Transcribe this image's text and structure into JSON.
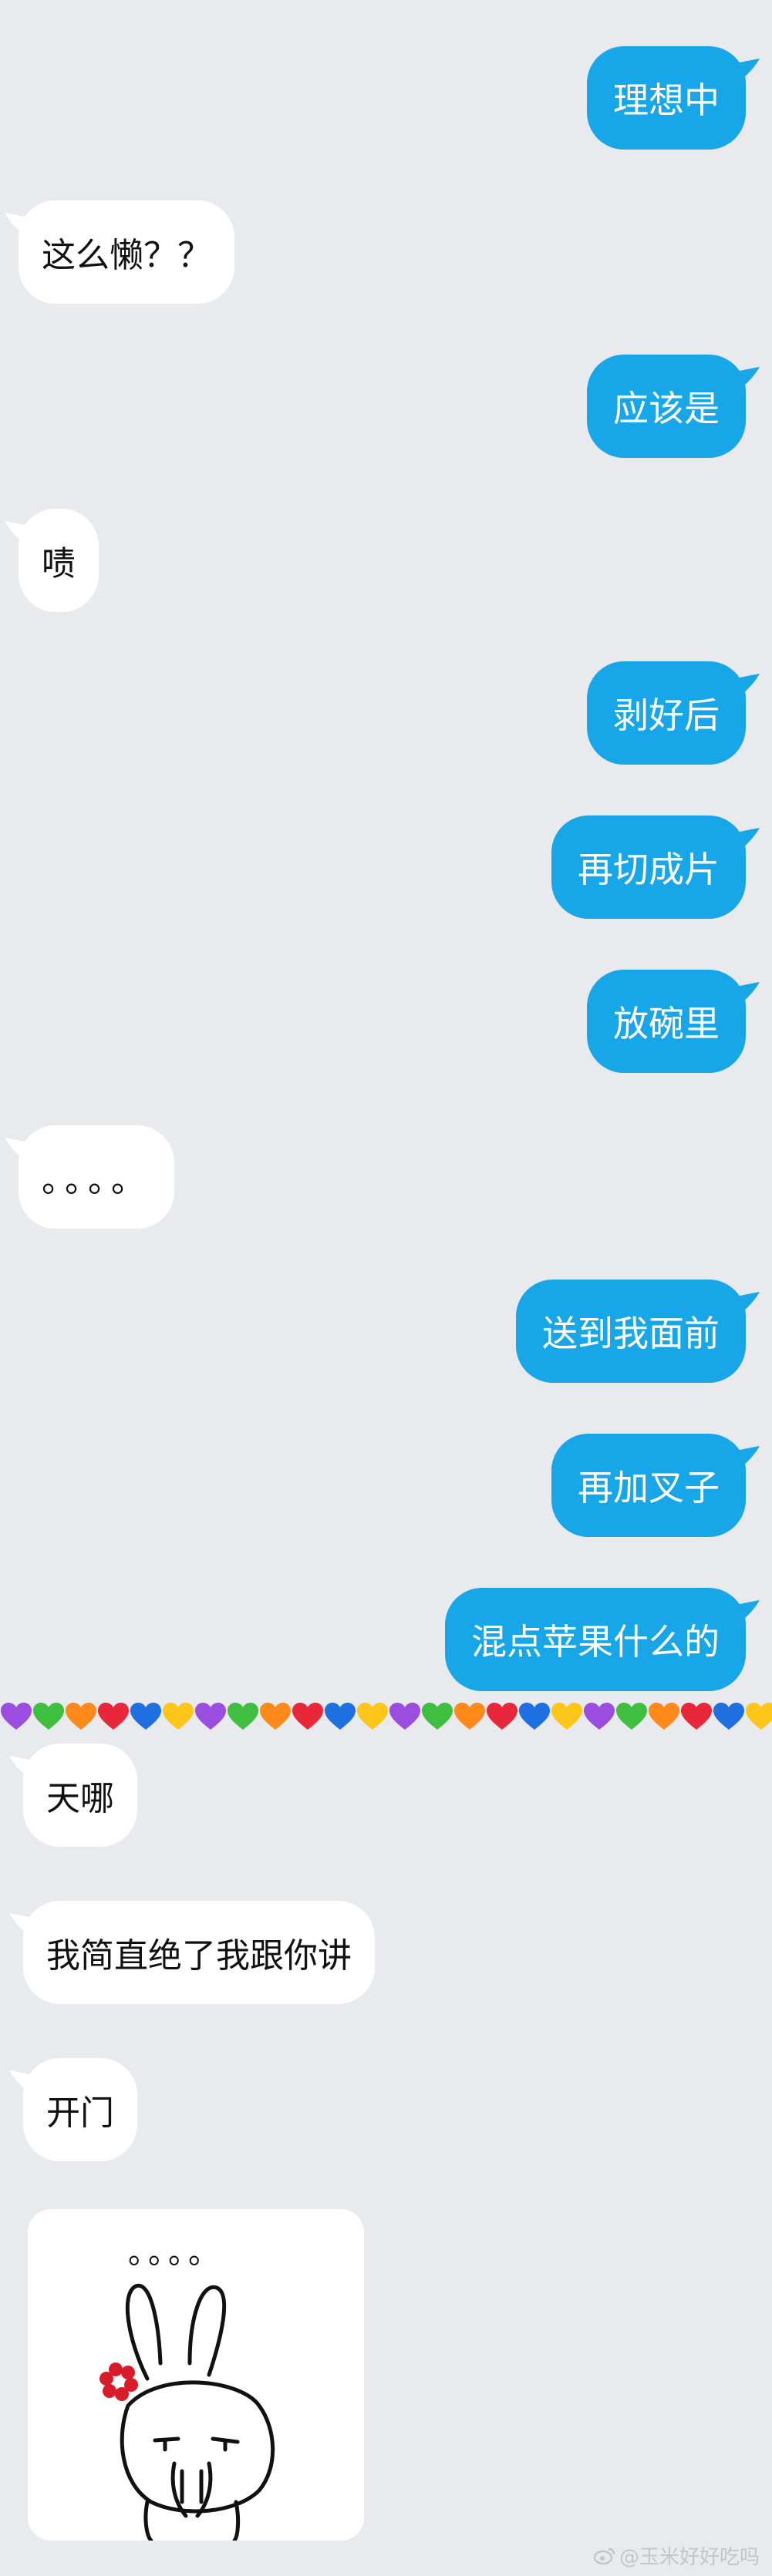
{
  "messages": [
    {
      "text": "理想中"
    },
    {
      "text": "这么懒？？"
    },
    {
      "text": "应该是"
    },
    {
      "text": "啧"
    },
    {
      "text": "剥好后"
    },
    {
      "text": "再切成片"
    },
    {
      "text": "放碗里"
    },
    {
      "text": "。。。。"
    },
    {
      "text": "送到我面前"
    },
    {
      "text": "再加叉子"
    },
    {
      "text": "混点苹果什么的"
    },
    {
      "text": "天哪"
    },
    {
      "text": "我简直绝了我跟你讲"
    },
    {
      "text": "开门"
    }
  ],
  "sticker": {
    "caption": "。。。。"
  },
  "divider": {
    "colors": [
      "#9b4de0",
      "#3fbf3f",
      "#ff8a1a",
      "#e8283a",
      "#1e6fe0",
      "#ffc61a"
    ]
  },
  "watermark": {
    "text": "@玉米好好吃吗"
  },
  "colors": {
    "sent_bubble": "#17a6e8",
    "received_bubble": "#ffffff",
    "background": "#e9eaee"
  }
}
